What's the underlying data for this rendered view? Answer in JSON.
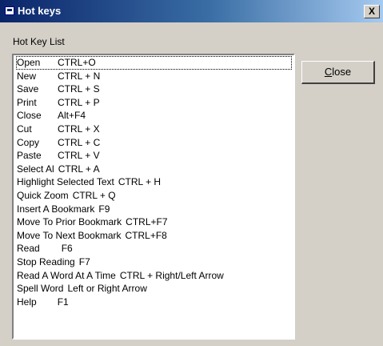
{
  "window": {
    "title": "Hot keys",
    "close_glyph": "X",
    "icon": "app-window-icon"
  },
  "caption": "Hot Key List",
  "close_button": {
    "mnemonic": "C",
    "rest": "lose"
  },
  "hotkeys": [
    {
      "name": "Open",
      "keys": "CTRL+O"
    },
    {
      "name": "New",
      "keys": "CTRL + N"
    },
    {
      "name": "Save",
      "keys": "CTRL + S"
    },
    {
      "name": "Print",
      "keys": "CTRL + P"
    },
    {
      "name": "Close",
      "keys": "Alt+F4"
    },
    {
      "name": "Cut",
      "keys": "CTRL + X"
    },
    {
      "name": "Copy",
      "keys": "CTRL + C"
    },
    {
      "name": "Paste",
      "keys": "CTRL + V"
    },
    {
      "name": "Select Al",
      "keys": "CTRL + A"
    },
    {
      "name": "Highlight Selected Text",
      "keys": "CTRL + H"
    },
    {
      "name": "Quick Zoom",
      "keys": "CTRL + Q"
    },
    {
      "name": "Insert A Bookmark",
      "keys": "F9"
    },
    {
      "name": "Move To Prior Bookmark",
      "keys": "CTRL+F7"
    },
    {
      "name": "Move To Next Bookmark",
      "keys": "CTRL+F8"
    },
    {
      "name": "Read",
      "keys": "F6"
    },
    {
      "name": "Stop Reading",
      "keys": "F7"
    },
    {
      "name": "Read A Word At A Time",
      "keys": "CTRL + Right/Left Arrow"
    },
    {
      "name": "Spell Word",
      "keys": "Left or Right Arrow"
    },
    {
      "name": "Help",
      "keys": "F1"
    }
  ]
}
